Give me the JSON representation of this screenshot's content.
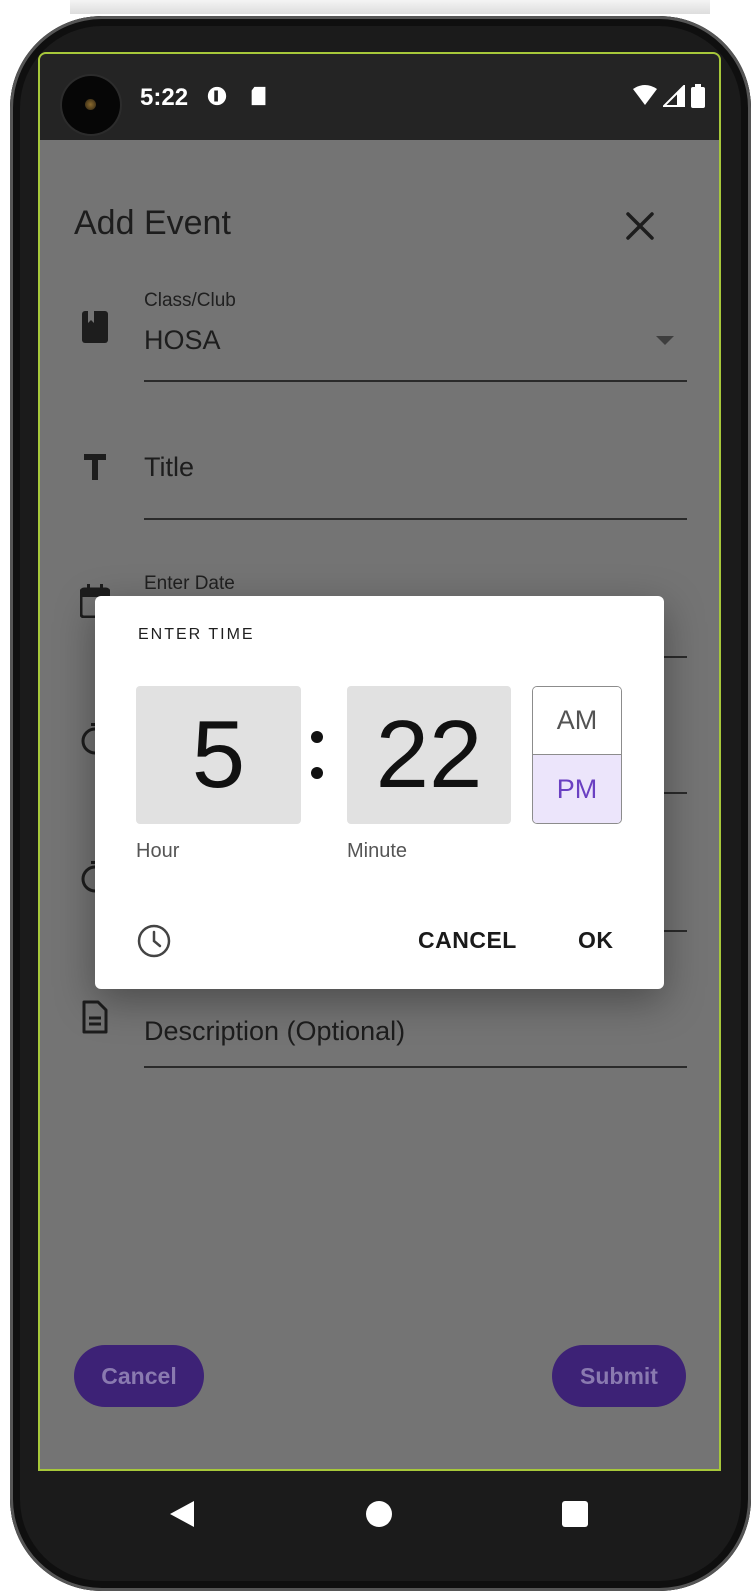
{
  "status_bar": {
    "time": "5:22"
  },
  "form": {
    "title": "Add Event",
    "class_club_label": "Class/Club",
    "class_club_value": "HOSA",
    "title_placeholder": "Title",
    "date_label": "Enter Date",
    "description_placeholder": "Description (Optional)",
    "cancel_label": "Cancel",
    "submit_label": "Submit"
  },
  "time_dialog": {
    "title": "ENTER TIME",
    "hour": "5",
    "minute": "22",
    "hour_caption": "Hour",
    "minute_caption": "Minute",
    "am_label": "AM",
    "pm_label": "PM",
    "selected_period": "PM",
    "cancel_label": "CANCEL",
    "ok_label": "OK"
  },
  "colors": {
    "scrim": "#747474",
    "accent": "#6a40c2",
    "button_fill": "#3d2276",
    "selected_period_bg": "#ece5fb",
    "screen_border": "#a7c83a"
  },
  "icons": {
    "class_club": "book-icon",
    "title": "text-icon",
    "date": "calendar-icon",
    "start_time": "timer-icon",
    "end_time": "timer-icon",
    "description": "document-icon",
    "close": "close-icon",
    "keyboard_toggle": "clock-icon"
  }
}
